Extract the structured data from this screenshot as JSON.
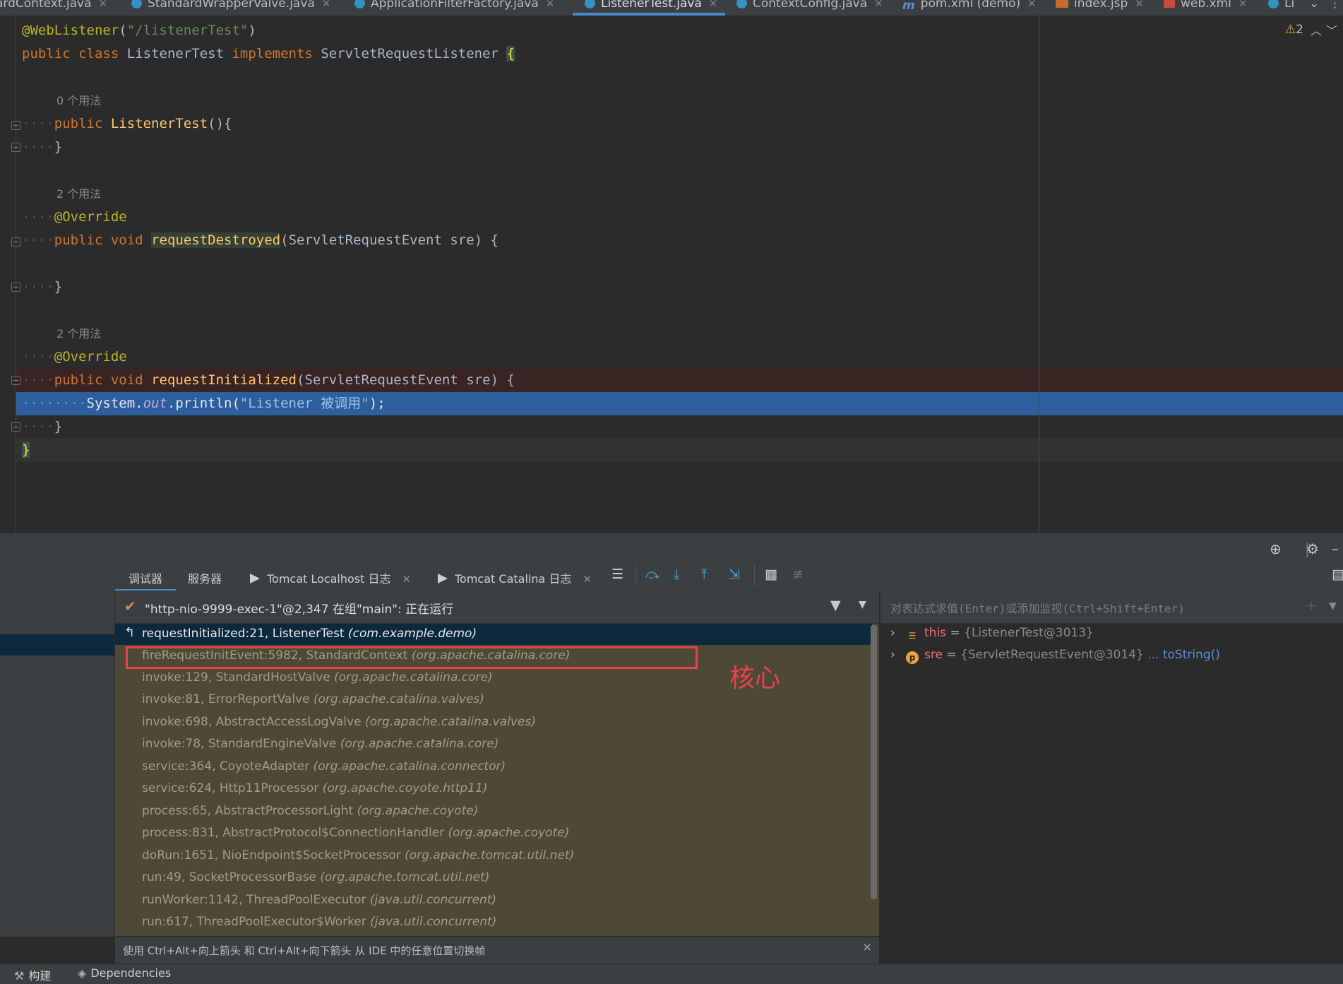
{
  "editor_tabs": [
    {
      "label": "ardContext.java",
      "icon": "java-class-icon"
    },
    {
      "label": "StandardWrapperValve.java",
      "icon": "java-class-icon"
    },
    {
      "label": "ApplicationFilterFactory.java",
      "icon": "java-class-icon"
    },
    {
      "label": "ListenerTest.java",
      "icon": "java-class-icon",
      "active": true
    },
    {
      "label": "ContextConfig.java",
      "icon": "java-class-icon"
    },
    {
      "label": "pom.xml (demo)",
      "icon": "maven-icon"
    },
    {
      "label": "index.jsp",
      "icon": "jsp-icon"
    },
    {
      "label": "web.xml",
      "icon": "xml-icon"
    },
    {
      "label": "Li",
      "icon": "java-class-icon"
    }
  ],
  "editor": {
    "warning_count": "2",
    "usage_hints": [
      "0 个用法",
      "2 个用法",
      "2 个用法"
    ],
    "code": {
      "ann_weblistener": "@WebListener",
      "weblistener_arg": "\"/listenerTest\"",
      "kw_public": "public",
      "kw_class": "class",
      "class_name": "ListenerTest",
      "kw_implements": "implements",
      "iface": "ServletRequestListener",
      "ctor_name": "ListenerTest",
      "ann_override": "@Override",
      "kw_void": "void",
      "m_destroyed": "requestDestroyed",
      "m_initialized": "requestInitialized",
      "param_type": "ServletRequestEvent",
      "param_name": "sre",
      "sys": "System",
      "out": "out",
      "println": "println",
      "msg": "\"Listener 被调用\""
    }
  },
  "debugger": {
    "tabs": [
      "调试器",
      "服务器",
      "Tomcat Localhost 日志",
      "Tomcat Catalina 日志"
    ],
    "thread_status": "\"http-nio-9999-exec-1\"@2,347 在组\"main\": 正在运行",
    "frames": [
      {
        "method": "requestInitialized:21, ListenerTest",
        "pkg": "(com.example.demo)"
      },
      {
        "method": "fireRequestInitEvent:5982, StandardContext",
        "pkg": "(org.apache.catalina.core)"
      },
      {
        "method": "invoke:129, StandardHostValve",
        "pkg": "(org.apache.catalina.core)"
      },
      {
        "method": "invoke:81, ErrorReportValve",
        "pkg": "(org.apache.catalina.valves)"
      },
      {
        "method": "invoke:698, AbstractAccessLogValve",
        "pkg": "(org.apache.catalina.valves)"
      },
      {
        "method": "invoke:78, StandardEngineValve",
        "pkg": "(org.apache.catalina.core)"
      },
      {
        "method": "service:364, CoyoteAdapter",
        "pkg": "(org.apache.catalina.connector)"
      },
      {
        "method": "service:624, Http11Processor",
        "pkg": "(org.apache.coyote.http11)"
      },
      {
        "method": "process:65, AbstractProcessorLight",
        "pkg": "(org.apache.coyote)"
      },
      {
        "method": "process:831, AbstractProtocol$ConnectionHandler",
        "pkg": "(org.apache.coyote)"
      },
      {
        "method": "doRun:1651, NioEndpoint$SocketProcessor",
        "pkg": "(org.apache.tomcat.util.net)"
      },
      {
        "method": "run:49, SocketProcessorBase",
        "pkg": "(org.apache.tomcat.util.net)"
      },
      {
        "method": "runWorker:1142, ThreadPoolExecutor",
        "pkg": "(java.util.concurrent)"
      },
      {
        "method": "run:617, ThreadPoolExecutor$Worker",
        "pkg": "(java.util.concurrent)"
      }
    ],
    "annotation": "核心",
    "frame_switch_hint": "使用 Ctrl+Alt+向上箭头 和 Ctrl+Alt+向下箭头 从 IDE 中的任意位置切换帧",
    "eval_placeholder": "对表达式求值(Enter)或添加监视(Ctrl+Shift+Enter)",
    "variables": [
      {
        "name": "this",
        "value": "{ListenerTest@3013}",
        "link": ""
      },
      {
        "name": "sre",
        "value": "{ServletRequestEvent@3014}",
        "link": "... toString()"
      }
    ]
  },
  "status_bar": {
    "build": "构建",
    "dependencies": "Dependencies"
  },
  "colors": {
    "accent": "#4a88c7",
    "annotation_red": "#e8434b",
    "current_line": "#2d5e9e",
    "frames_bg": "#4e4837"
  }
}
